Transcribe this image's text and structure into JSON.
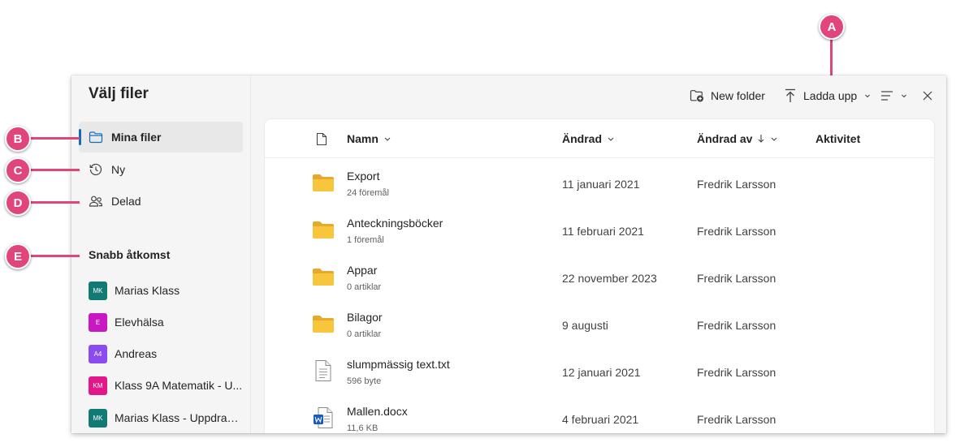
{
  "dialog": {
    "title": "Välj filer",
    "nav": [
      {
        "label": "Mina filer",
        "icon": "folder-icon"
      },
      {
        "label": "Ny",
        "icon": "history-icon"
      },
      {
        "label": "Delad",
        "icon": "people-icon"
      }
    ],
    "quick_access": {
      "title": "Snabb åtkomst",
      "items": [
        {
          "label": "Marias Klass",
          "badge": "MK",
          "color": "#117a74"
        },
        {
          "label": "Elevhälsa",
          "badge": "E",
          "color": "#c818c1"
        },
        {
          "label": "Andreas",
          "badge": "A4",
          "color": "#8a4cf0"
        },
        {
          "label": "Klass 9A Matematik - U...",
          "badge": "KM",
          "color": "#e3178a"
        },
        {
          "label": "Marias Klass - Uppdrag ...",
          "badge": "MK",
          "color": "#117a74"
        }
      ]
    },
    "toolbar": {
      "new_folder": "New folder",
      "upload": "Ladda upp"
    },
    "columns": {
      "name": "Namn",
      "modified": "Ändrad",
      "modified_by": "Ändrad av",
      "activity": "Aktivitet"
    },
    "files": [
      {
        "name": "Export",
        "meta": "24 föremål",
        "modified": "11 januari 2021",
        "by": "Fredrik Larsson",
        "type": "folder"
      },
      {
        "name": "Anteckningsböcker",
        "meta": "1 föremål",
        "modified": "11 februari 2021",
        "by": "Fredrik Larsson",
        "type": "folder"
      },
      {
        "name": "Appar",
        "meta": "0 artiklar",
        "modified": "22 november 2023",
        "by": "Fredrik Larsson",
        "type": "folder"
      },
      {
        "name": "Bilagor",
        "meta": "0 artiklar",
        "modified": "9 augusti",
        "by": "Fredrik Larsson",
        "type": "folder"
      },
      {
        "name": "slumpmässig text.txt",
        "meta": "596 byte",
        "modified": "12 januari 2021",
        "by": "Fredrik Larsson",
        "type": "text-file"
      },
      {
        "name": "Mallen.docx",
        "meta": "11,6 KB",
        "modified": "4 februari 2021",
        "by": "Fredrik Larsson",
        "type": "word-file"
      }
    ]
  },
  "callouts": [
    "A",
    "B",
    "C",
    "D",
    "E"
  ],
  "colors": {
    "accent": "#0f6cbd",
    "callout": "#e0457b",
    "folder": "#f8c63d"
  }
}
